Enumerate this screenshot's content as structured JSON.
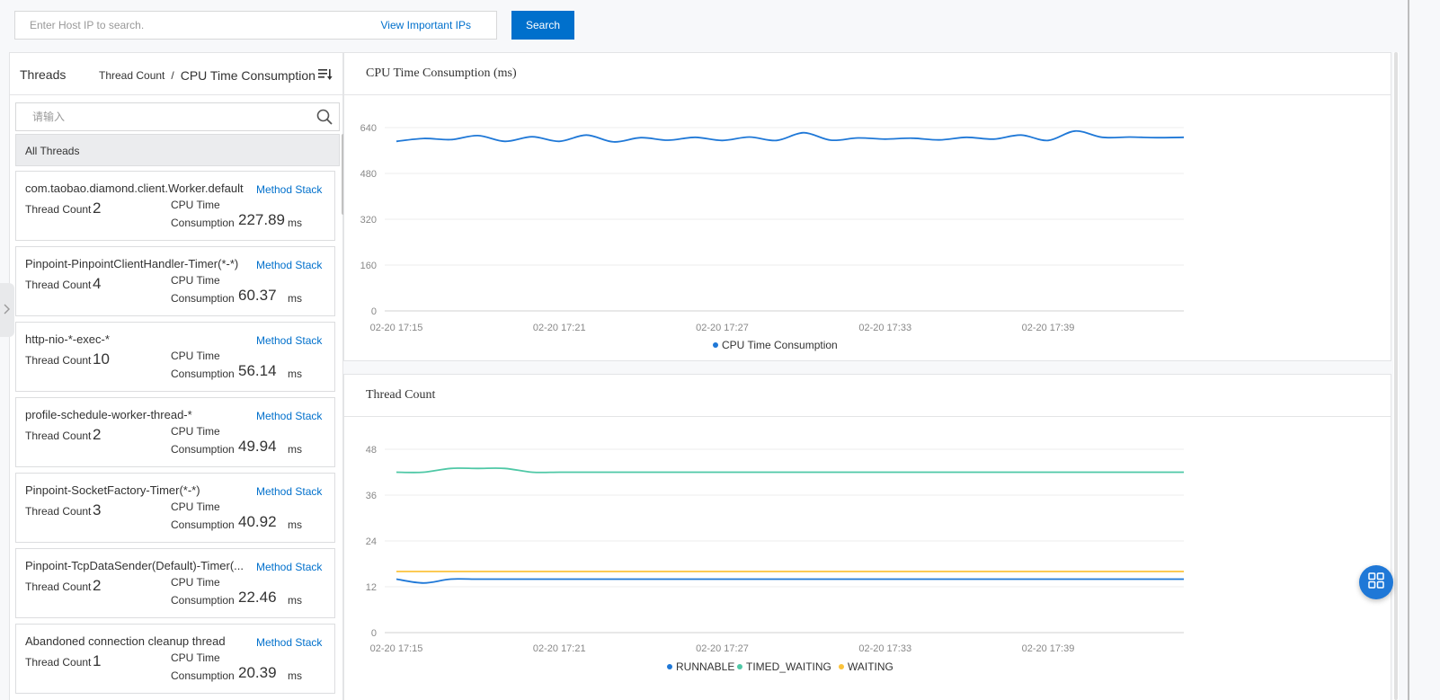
{
  "search": {
    "placeholder": "Enter Host IP to search.",
    "important_link": "View Important IPs",
    "button": "Search"
  },
  "threads_panel": {
    "title": "Threads",
    "sort_thread_count": "Thread Count",
    "sort_separator": "/",
    "sort_cpu_time": "CPU Time Consumption",
    "filter_placeholder": "请输入",
    "all_threads": "All Threads",
    "card_labels": {
      "thread_count": "Thread Count",
      "cpu_line1": "CPU Time",
      "cpu_line2": "Consumption",
      "unit": "ms",
      "method_stack": "Method Stack"
    },
    "items": [
      {
        "name": "com.taobao.diamond.client.Worker.default",
        "count": "2",
        "cpu": "227.89"
      },
      {
        "name": "Pinpoint-PinpointClientHandler-Timer(*-*)",
        "count": "4",
        "cpu": "60.37"
      },
      {
        "name": "http-nio-*-exec-*",
        "count": "10",
        "cpu": "56.14"
      },
      {
        "name": "profile-schedule-worker-thread-*",
        "count": "2",
        "cpu": "49.94"
      },
      {
        "name": "Pinpoint-SocketFactory-Timer(*-*)",
        "count": "3",
        "cpu": "40.92"
      },
      {
        "name": "Pinpoint-TcpDataSender(Default)-Timer(...",
        "count": "2",
        "cpu": "22.46"
      },
      {
        "name": "Abandoned connection cleanup thread",
        "count": "1",
        "cpu": "20.39"
      }
    ]
  },
  "cpu_chart": {
    "title": "CPU Time Consumption (ms)"
  },
  "thread_chart": {
    "title": "Thread Count"
  },
  "icons": {
    "sort": "sort-descending-icon",
    "search": "magnifier-icon",
    "collapse": "chevron-right-icon",
    "fab": "grid-apps-icon"
  },
  "colors": {
    "primary": "#0070cc",
    "runnable": "#1f78d7",
    "timed_waiting": "#4fc8a6",
    "waiting": "#fbc33b"
  },
  "chart_data": [
    {
      "type": "line",
      "title": "CPU Time Consumption (ms)",
      "x": [
        "02-20 17:15",
        "02-20 17:16",
        "02-20 17:17",
        "02-20 17:18",
        "02-20 17:19",
        "02-20 17:20",
        "02-20 17:21",
        "02-20 17:22",
        "02-20 17:23",
        "02-20 17:24",
        "02-20 17:25",
        "02-20 17:26",
        "02-20 17:27",
        "02-20 17:28",
        "02-20 17:29",
        "02-20 17:30",
        "02-20 17:31",
        "02-20 17:32",
        "02-20 17:33",
        "02-20 17:34",
        "02-20 17:35",
        "02-20 17:36",
        "02-20 17:37",
        "02-20 17:38",
        "02-20 17:39",
        "02-20 17:40",
        "02-20 17:41",
        "02-20 17:42",
        "02-20 17:43",
        "02-20 17:44"
      ],
      "x_ticks": [
        "02-20 17:15",
        "02-20 17:21",
        "02-20 17:27",
        "02-20 17:33",
        "02-20 17:39"
      ],
      "series": [
        {
          "name": "CPU Time Consumption",
          "color": "#1f78d7",
          "values": [
            592,
            602,
            598,
            612,
            592,
            608,
            592,
            614,
            590,
            605,
            596,
            606,
            595,
            607,
            595,
            622,
            596,
            604,
            600,
            603,
            597,
            606,
            600,
            614,
            595,
            628,
            606,
            607,
            605,
            606
          ]
        }
      ],
      "yticks": [
        0,
        160,
        320,
        480,
        640
      ],
      "ylim": [
        0,
        640
      ],
      "grid": true,
      "legend": "bottom-center"
    },
    {
      "type": "line",
      "title": "Thread Count",
      "x": [
        "02-20 17:15",
        "02-20 17:16",
        "02-20 17:17",
        "02-20 17:18",
        "02-20 17:19",
        "02-20 17:20",
        "02-20 17:21",
        "02-20 17:22",
        "02-20 17:23",
        "02-20 17:24",
        "02-20 17:25",
        "02-20 17:26",
        "02-20 17:27",
        "02-20 17:28",
        "02-20 17:29",
        "02-20 17:30",
        "02-20 17:31",
        "02-20 17:32",
        "02-20 17:33",
        "02-20 17:34",
        "02-20 17:35",
        "02-20 17:36",
        "02-20 17:37",
        "02-20 17:38",
        "02-20 17:39",
        "02-20 17:40",
        "02-20 17:41",
        "02-20 17:42",
        "02-20 17:43",
        "02-20 17:44"
      ],
      "x_ticks": [
        "02-20 17:15",
        "02-20 17:21",
        "02-20 17:27",
        "02-20 17:33",
        "02-20 17:39"
      ],
      "series": [
        {
          "name": "RUNNABLE",
          "color": "#1f78d7",
          "values": [
            14,
            13,
            14,
            14,
            14,
            14,
            14,
            14,
            14,
            14,
            14,
            14,
            14,
            14,
            14,
            14,
            14,
            14,
            14,
            14,
            14,
            14,
            14,
            14,
            14,
            14,
            14,
            14,
            14,
            14
          ]
        },
        {
          "name": "TIMED_WAITING",
          "color": "#4fc8a6",
          "values": [
            42,
            42,
            43,
            43,
            43,
            42,
            42,
            42,
            42,
            42,
            42,
            42,
            42,
            42,
            42,
            42,
            42,
            42,
            42,
            42,
            42,
            42,
            42,
            42,
            42,
            42,
            42,
            42,
            42,
            42
          ]
        },
        {
          "name": "WAITING",
          "color": "#fbc33b",
          "values": [
            16,
            16,
            16,
            16,
            16,
            16,
            16,
            16,
            16,
            16,
            16,
            16,
            16,
            16,
            16,
            16,
            16,
            16,
            16,
            16,
            16,
            16,
            16,
            16,
            16,
            16,
            16,
            16,
            16,
            16
          ]
        }
      ],
      "yticks": [
        0,
        12,
        24,
        36,
        48
      ],
      "ylim": [
        0,
        48
      ],
      "grid": true,
      "legend": "bottom-center"
    }
  ]
}
